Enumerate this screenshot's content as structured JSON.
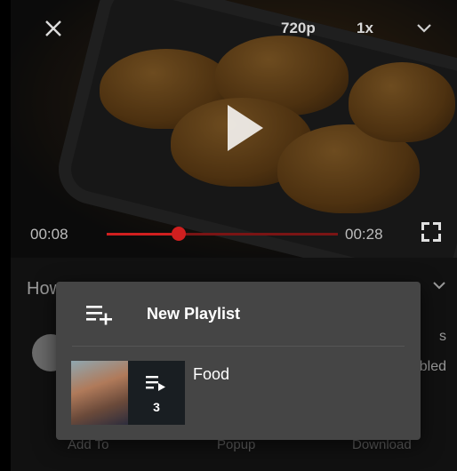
{
  "player": {
    "quality": "720p",
    "speed": "1x",
    "current_time": "00:08",
    "duration": "00:28",
    "progress": 0.31
  },
  "details": {
    "title_partial": "How",
    "side_text_1": "s",
    "side_text_2": "bled",
    "actions": [
      "Add To",
      "Popup",
      "Download"
    ]
  },
  "dialog": {
    "new_playlist_label": "New Playlist",
    "playlists": [
      {
        "name": "Food",
        "count": "3"
      }
    ]
  },
  "colors": {
    "seek_accent": "#d01f1f",
    "dialog_bg": "#454545"
  }
}
